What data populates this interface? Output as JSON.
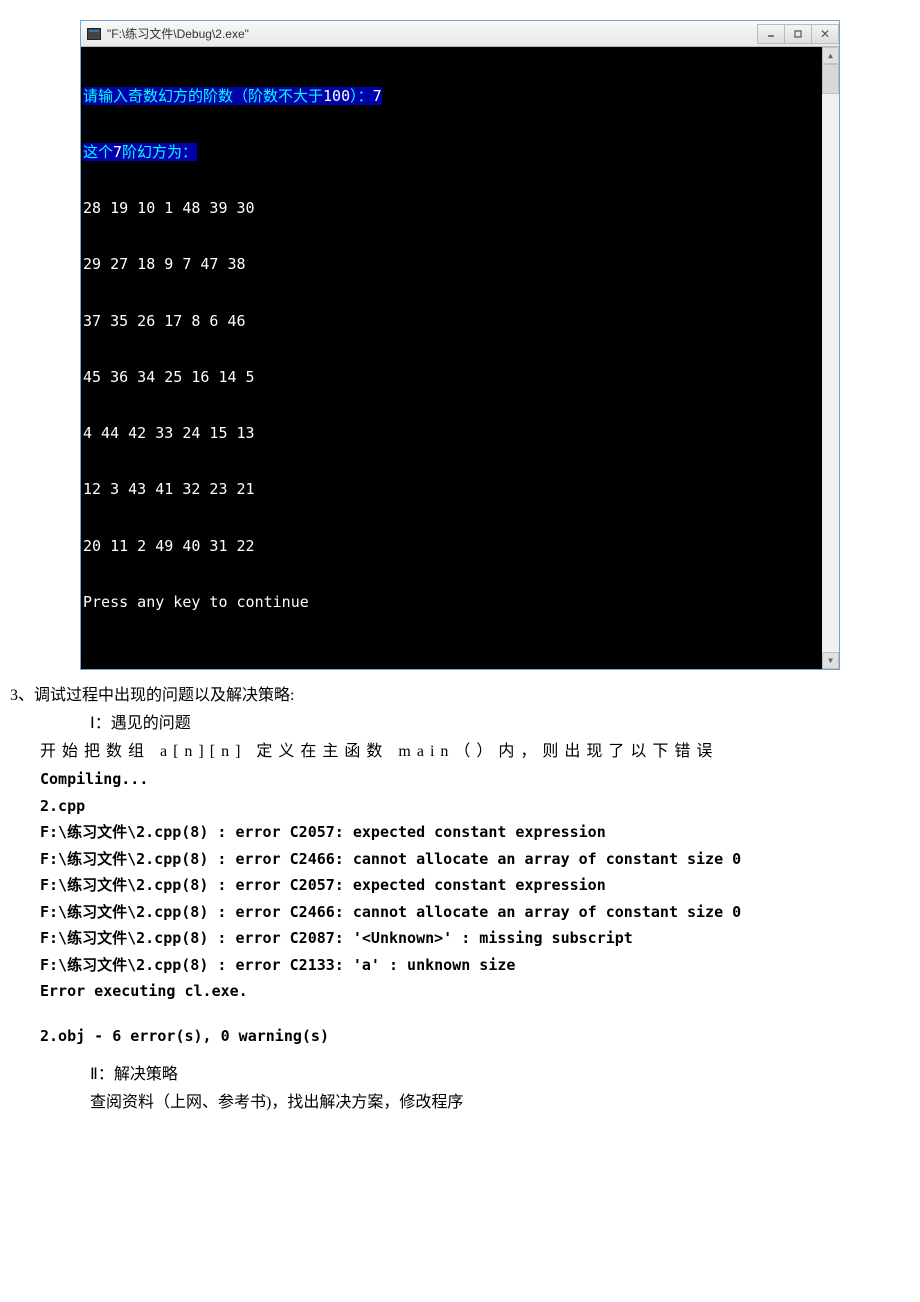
{
  "window": {
    "title": "\"F:\\练习文件\\Debug\\2.exe\""
  },
  "console": {
    "line1_pre": "请输入奇数幻方的阶数（阶数不大于",
    "line1_num": "100",
    "line1_post": "）：",
    "line1_input": "7",
    "line2_pre": "这个",
    "line2_num": "7",
    "line2_post": "阶幻方为：",
    "matrix": [
      "28 19 10 1 48 39 30",
      "29 27 18 9 7 47 38",
      "37 35 26 17 8 6 46",
      "45 36 34 25 16 14 5",
      "4 44 42 33 24 15 13",
      "12 3 43 41 32 23 21",
      "20 11 2 49 40 31 22"
    ],
    "press": "Press any key to continue"
  },
  "doc": {
    "section3": "3、调试过程中出现的问题以及解决策略:",
    "sub1": "Ⅰ：遇见的问题",
    "para1": "开始把数组 a[n][n] 定义在主函数 main（）内，则出现了以下错误",
    "compiling": "Compiling...",
    "file": "2.cpp",
    "errors": [
      "F:\\练习文件\\2.cpp(8) : error C2057: expected constant expression",
      "F:\\练习文件\\2.cpp(8) : error C2466: cannot allocate an array of constant size 0",
      "F:\\练习文件\\2.cpp(8) : error C2057: expected constant expression",
      "F:\\练习文件\\2.cpp(8) : error C2466: cannot allocate an array of constant size 0",
      "F:\\练习文件\\2.cpp(8) : error C2087: '<Unknown>' : missing subscript",
      "F:\\练习文件\\2.cpp(8) : error C2133: 'a' : unknown size"
    ],
    "errexec": "Error executing cl.exe.",
    "summary": "2.obj - 6 error(s), 0 warning(s)",
    "sub2": "Ⅱ：解决策略",
    "para2": "查阅资料（上网、参考书)，找出解决方案，修改程序"
  }
}
